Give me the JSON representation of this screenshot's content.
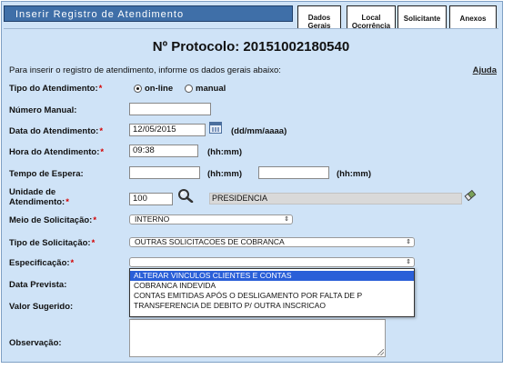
{
  "title": "Inserir Registro de Atendimento",
  "tabs": [
    {
      "label_line1": "Dados",
      "label_line2": "Gerais"
    },
    {
      "label_line1": "Local",
      "label_line2": "Ocorrência"
    },
    {
      "label": "Solicitante"
    },
    {
      "label": "Anexos"
    }
  ],
  "protocol": "Nº Protocolo: 20151002180540",
  "intro": "Para inserir o registro de atendimento, informe os dados gerais abaixo:",
  "help_link": "Ajuda",
  "fields": {
    "tipo_atendimento": {
      "label": "Tipo do Atendimento:",
      "required": "*",
      "option_online": "on-line",
      "option_manual": "manual",
      "selected": "on-line"
    },
    "numero_manual": {
      "label": "Número Manual:",
      "value": ""
    },
    "data_atendimento": {
      "label": "Data do Atendimento:",
      "required": "*",
      "value": "12/05/2015",
      "hint": "(dd/mm/aaaa)"
    },
    "hora_atendimento": {
      "label": "Hora do Atendimento:",
      "required": "*",
      "value": "09:38",
      "hint": "(hh:mm)"
    },
    "tempo_espera": {
      "label": "Tempo de Espera:",
      "value_start": "",
      "hint_start": "(hh:mm)",
      "value_end": "",
      "hint_end": "(hh:mm)"
    },
    "unidade_atendimento": {
      "label_line1": "Unidade de",
      "label_line2": "Atendimento:",
      "required": "*",
      "code": "100",
      "name": "PRESIDENCIA"
    },
    "meio_solicitacao": {
      "label": "Meio de Solicitação:",
      "required": "*",
      "value": "INTERNO"
    },
    "tipo_solicitacao": {
      "label": "Tipo de Solicitação:",
      "required": "*",
      "value": "OUTRAS SOLICITACOES DE COBRANCA"
    },
    "especificacao": {
      "label": "Especificação:",
      "required": "*",
      "value": "",
      "options": [
        "ALTERAR VINCULOS CLIENTES E CONTAS",
        "COBRANCA INDEVIDA",
        "CONTAS EMITIDAS APÓS O DESLIGAMENTO POR FALTA DE P",
        "TRANSFERENCIA DE DEBITO P/ OUTRA INSCRICAO"
      ],
      "highlighted": "ALTERAR VINCULOS CLIENTES E CONTAS"
    },
    "data_prevista": {
      "label": "Data Prevista:"
    },
    "valor_sugerido": {
      "label": "Valor Sugerido:"
    },
    "observacao": {
      "label": "Observação:",
      "value": ""
    }
  },
  "icons": {
    "calendar": "calendar-icon",
    "search": "magnifier-icon",
    "clear": "eraser-icon",
    "arrow": "updown-arrow-icon"
  },
  "colors": {
    "panel_bg": "#cfe3f7",
    "title_bg": "#3f6fa8",
    "required": "#d40000",
    "selection": "#2a5fd8"
  }
}
